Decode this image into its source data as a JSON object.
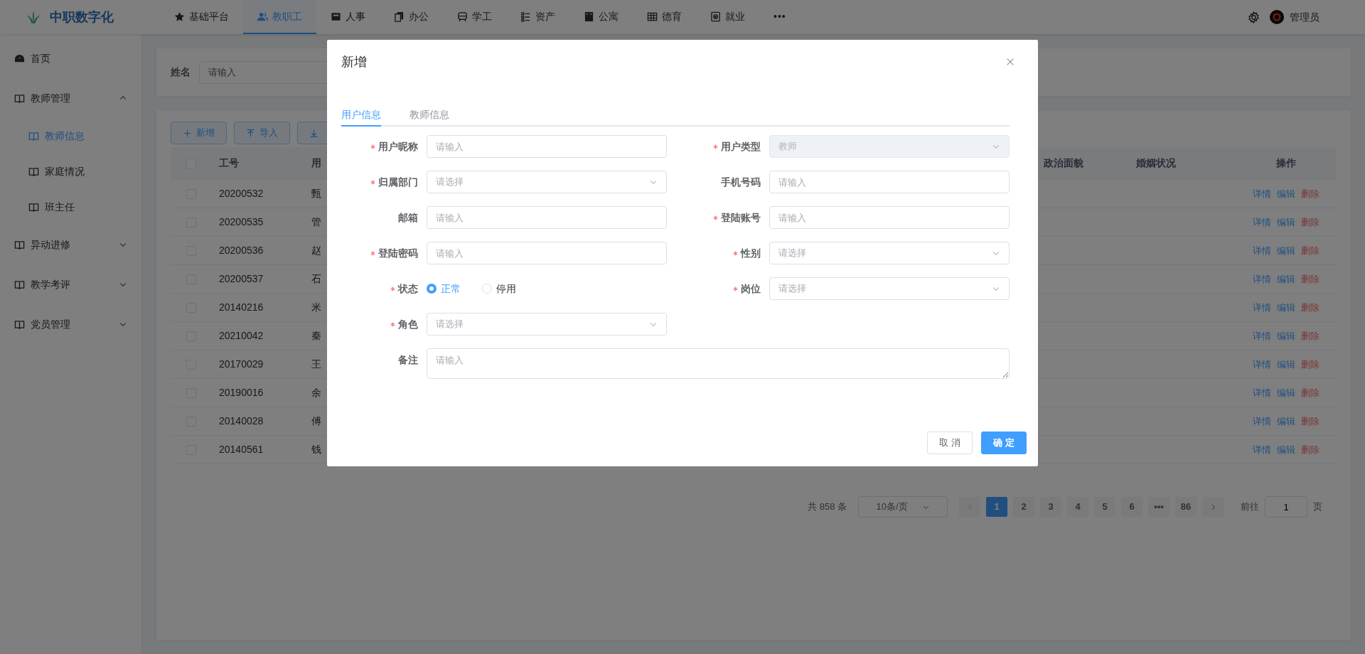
{
  "header": {
    "logo_text": "中职数字化",
    "nav": [
      {
        "label": "基础平台",
        "selected": false
      },
      {
        "label": "教职工",
        "selected": true
      },
      {
        "label": "人事",
        "selected": false
      },
      {
        "label": "办公",
        "selected": false
      },
      {
        "label": "学工",
        "selected": false
      },
      {
        "label": "资产",
        "selected": false
      },
      {
        "label": "公寓",
        "selected": false
      },
      {
        "label": "德育",
        "selected": false
      },
      {
        "label": "就业",
        "selected": false
      }
    ],
    "more": "•••",
    "user": "管理员"
  },
  "sidebar": {
    "items": [
      {
        "label": "首页",
        "selected": false
      },
      {
        "label": "教师管理",
        "selected": false,
        "expanded": true,
        "children": [
          {
            "label": "教师信息",
            "selected": true
          },
          {
            "label": "家庭情况",
            "selected": false
          },
          {
            "label": "班主任",
            "selected": false
          }
        ]
      },
      {
        "label": "异动进修",
        "selected": false,
        "expanded": false
      },
      {
        "label": "教学考评",
        "selected": false,
        "expanded": false
      },
      {
        "label": "党员管理",
        "selected": false,
        "expanded": false
      }
    ]
  },
  "search": {
    "label": "姓名",
    "placeholder": "请输入"
  },
  "toolbar": [
    {
      "kind": "add",
      "label": "新增"
    },
    {
      "kind": "import",
      "label": "导入"
    },
    {
      "kind": "export"
    }
  ],
  "table": {
    "header_checked": false,
    "columns": [
      "工号",
      "用",
      "政治面貌",
      "婚姻状况",
      "操作"
    ],
    "rows": [
      {
        "id": "20200532",
        "user": "甄",
        "checked": false,
        "actions": [
          {
            "kind": "view",
            "label": "详情"
          },
          {
            "kind": "edit",
            "label": "编辑"
          },
          {
            "kind": "delete",
            "label": "删除"
          }
        ]
      },
      {
        "id": "20200535",
        "user": "管",
        "checked": false,
        "actions": [
          {
            "kind": "view",
            "label": "详情"
          },
          {
            "kind": "edit",
            "label": "编辑"
          },
          {
            "kind": "delete",
            "label": "删除"
          }
        ]
      },
      {
        "id": "20200536",
        "user": "赵",
        "checked": false,
        "actions": [
          {
            "kind": "view",
            "label": "详情"
          },
          {
            "kind": "edit",
            "label": "编辑"
          },
          {
            "kind": "delete",
            "label": "删除"
          }
        ]
      },
      {
        "id": "20200537",
        "user": "石",
        "checked": false,
        "actions": [
          {
            "kind": "view",
            "label": "详情"
          },
          {
            "kind": "edit",
            "label": "编辑"
          },
          {
            "kind": "delete",
            "label": "删除"
          }
        ]
      },
      {
        "id": "20140216",
        "user": "米",
        "checked": false,
        "actions": [
          {
            "kind": "view",
            "label": "详情"
          },
          {
            "kind": "edit",
            "label": "编辑"
          },
          {
            "kind": "delete",
            "label": "删除"
          }
        ]
      },
      {
        "id": "20210042",
        "user": "秦",
        "checked": false,
        "actions": [
          {
            "kind": "view",
            "label": "详情"
          },
          {
            "kind": "edit",
            "label": "编辑"
          },
          {
            "kind": "delete",
            "label": "删除"
          }
        ]
      },
      {
        "id": "20170029",
        "user": "王",
        "checked": false,
        "actions": [
          {
            "kind": "view",
            "label": "详情"
          },
          {
            "kind": "edit",
            "label": "编辑"
          },
          {
            "kind": "delete",
            "label": "删除"
          }
        ]
      },
      {
        "id": "20190016",
        "user": "余",
        "checked": false,
        "actions": [
          {
            "kind": "view",
            "label": "详情"
          },
          {
            "kind": "edit",
            "label": "编辑"
          },
          {
            "kind": "delete",
            "label": "删除"
          }
        ]
      },
      {
        "id": "20140028",
        "user": "傅",
        "checked": false,
        "actions": [
          {
            "kind": "view",
            "label": "详情"
          },
          {
            "kind": "edit",
            "label": "编辑"
          },
          {
            "kind": "delete",
            "label": "删除"
          }
        ]
      },
      {
        "id": "20140561",
        "user": "钱",
        "checked": false,
        "actions": [
          {
            "kind": "view",
            "label": "详情"
          },
          {
            "kind": "edit",
            "label": "编辑"
          },
          {
            "kind": "delete",
            "label": "删除"
          }
        ]
      }
    ]
  },
  "pagination": {
    "total": "共 858 条",
    "page_size": "10条/页",
    "prev_disabled": true,
    "pages": [
      {
        "label": "1",
        "selected": true
      },
      {
        "label": "2",
        "selected": false
      },
      {
        "label": "3",
        "selected": false
      },
      {
        "label": "4",
        "selected": false
      },
      {
        "label": "5",
        "selected": false
      },
      {
        "label": "6",
        "selected": false
      },
      {
        "label": "•••",
        "selected": false
      },
      {
        "label": "86",
        "selected": false
      }
    ],
    "goto_label": "前往",
    "goto_value": "1",
    "goto_suffix": "页"
  },
  "dialog": {
    "title": "新增",
    "tabs": [
      {
        "label": "用户信息",
        "selected": true
      },
      {
        "label": "教师信息",
        "selected": false
      }
    ],
    "fields": [
      {
        "kind": "input",
        "label": "用户昵称",
        "required": true,
        "placeholder": "请输入",
        "disabled": false
      },
      {
        "kind": "select",
        "label": "用户类型",
        "required": true,
        "value": "教师",
        "disabled": true
      },
      {
        "kind": "select",
        "label": "归属部门",
        "required": true,
        "placeholder": "请选择",
        "disabled": false
      },
      {
        "kind": "input",
        "label": "手机号码",
        "required": false,
        "placeholder": "请输入",
        "disabled": false
      },
      {
        "kind": "input",
        "label": "邮箱",
        "required": false,
        "placeholder": "请输入",
        "disabled": false
      },
      {
        "kind": "input",
        "label": "登陆账号",
        "required": true,
        "placeholder": "请输入",
        "disabled": false
      },
      {
        "kind": "input",
        "label": "登陆密码",
        "required": true,
        "placeholder": "请输入",
        "disabled": false
      },
      {
        "kind": "select",
        "label": "性别",
        "required": true,
        "placeholder": "请选择",
        "disabled": false
      },
      {
        "kind": "radio",
        "label": "状态",
        "required": true,
        "options": [
          {
            "label": "正常",
            "selected": true
          },
          {
            "label": "停用",
            "selected": false
          }
        ]
      },
      {
        "kind": "select",
        "label": "岗位",
        "required": true,
        "placeholder": "请选择",
        "disabled": false
      },
      {
        "kind": "select",
        "label": "角色",
        "required": true,
        "placeholder": "请选择",
        "disabled": false
      },
      {
        "kind": "textarea",
        "label": "备注",
        "required": false,
        "placeholder": "请输入"
      }
    ],
    "buttons": [
      {
        "kind": "secondary",
        "label": "取 消"
      },
      {
        "kind": "primary",
        "label": "确 定"
      }
    ]
  }
}
